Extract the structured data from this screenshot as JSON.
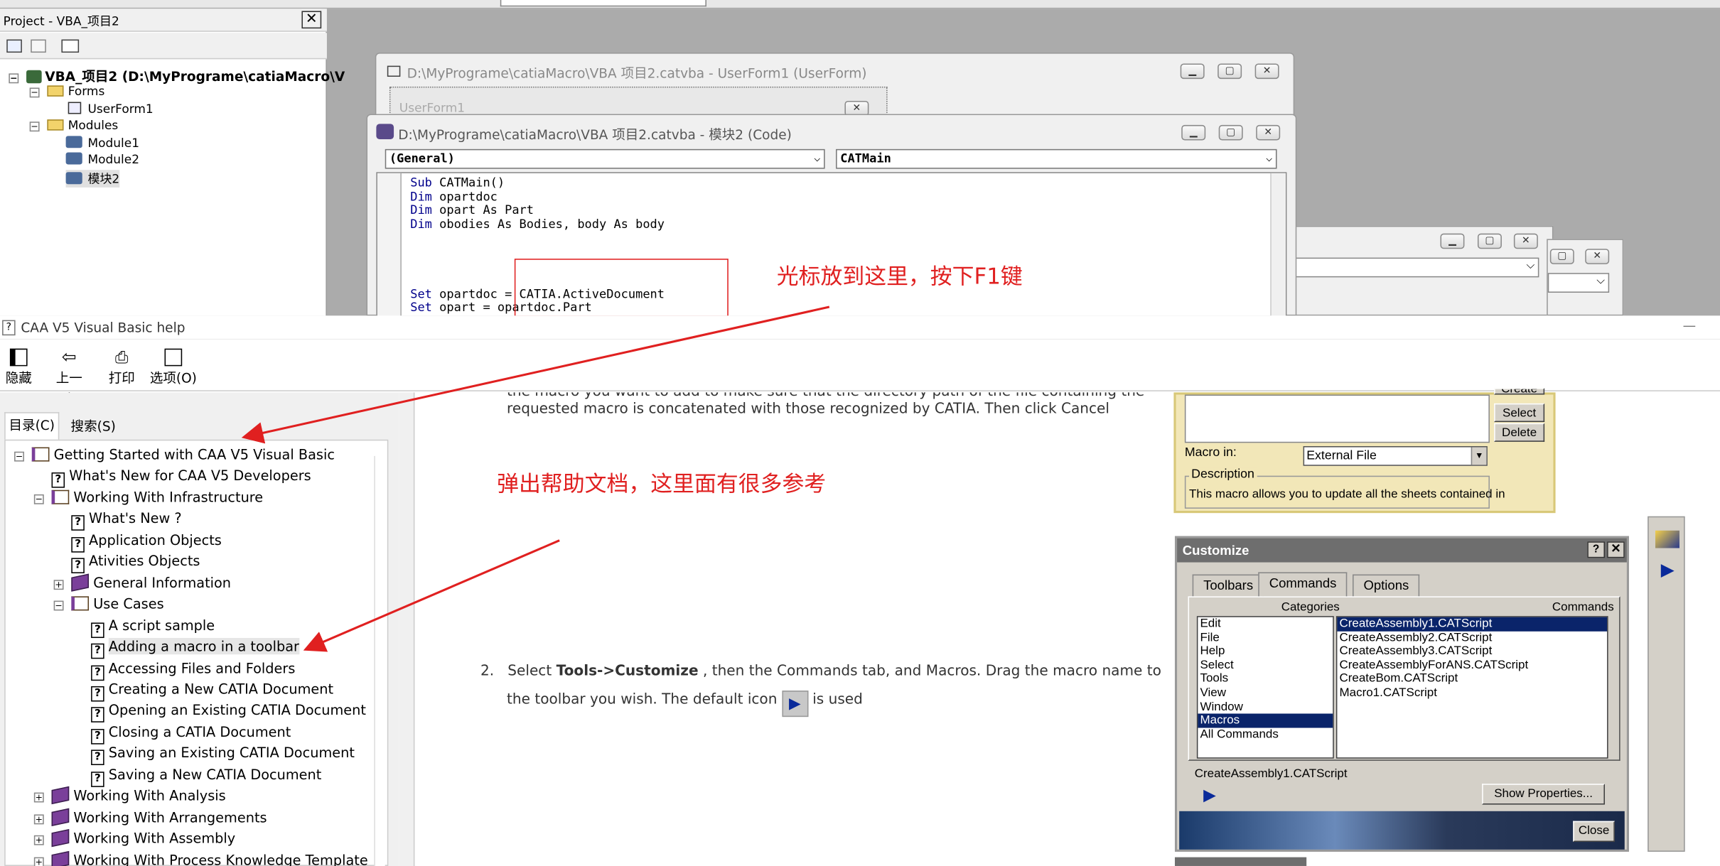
{
  "vba": {
    "project_title": "Project - VBA_项目2",
    "tree_root": "VBA_项目2 (D:\\MyPrograme\\catiaMacro\\V",
    "tree_forms": "Forms",
    "tree_userform": "UserForm1",
    "tree_modules": "Modules",
    "tree_module1": "Module1",
    "tree_module2": "Module2",
    "tree_module3": "模块2",
    "userform_window_title": "D:\\MyPrograme\\catiaMacro\\VBA 项目2.catvba - UserForm1 (UserForm)",
    "userform_caption": "UserForm1",
    "code_window_title": "D:\\MyPrograme\\catiaMacro\\VBA 项目2.catvba - 模块2 (Code)",
    "object_combo": "(General)",
    "proc_combo": "CATMain",
    "code_lines": [
      {
        "kw": "Sub",
        "rest": " CATMain()"
      },
      {
        "kw": "Dim",
        "rest": " opartdoc"
      },
      {
        "kw": "Dim",
        "rest": " opart As Part"
      },
      {
        "kw": "Dim",
        "rest": " obodies As Bodies, body As body"
      },
      {
        "kw": "",
        "rest": ""
      },
      {
        "kw": "",
        "rest": ""
      },
      {
        "kw": "",
        "rest": ""
      },
      {
        "kw": "",
        "rest": ""
      },
      {
        "kw": "Set",
        "rest": " opartdoc = CATIA.ActiveDocument"
      },
      {
        "kw": "Set",
        "rest": " opart = opartdoc.Part"
      }
    ]
  },
  "annotations": {
    "cursor_note": "光标放到这里，按下F1键",
    "help_note": "弹出帮助文档，这里面有很多参考",
    "color": "#e02020"
  },
  "help": {
    "title": "CAA V5 Visual Basic help",
    "toolbar": {
      "hide": "隐藏",
      "back": "上一步",
      "print": "打印",
      "options": "选项(O)"
    },
    "tabs": {
      "contents": "目录(C)",
      "search": "搜索(S)"
    },
    "tree": [
      {
        "label": "Getting Started with CAA V5 Visual Basic",
        "icon": "open-book-icon",
        "exp": "−",
        "level": 0
      },
      {
        "label": "What's New for CAA V5 Developers",
        "icon": "help-page-icon",
        "exp": "",
        "level": 1
      },
      {
        "label": "Working With Infrastructure",
        "icon": "open-book-icon",
        "exp": "−",
        "level": 1
      },
      {
        "label": "What's New ?",
        "icon": "help-page-icon",
        "exp": "",
        "level": 2
      },
      {
        "label": "Application Objects",
        "icon": "help-page-icon",
        "exp": "",
        "level": 2
      },
      {
        "label": "Ativities Objects",
        "icon": "help-page-icon",
        "exp": "",
        "level": 2
      },
      {
        "label": "General Information",
        "icon": "book-icon",
        "exp": "+",
        "level": 2
      },
      {
        "label": "Use Cases",
        "icon": "open-book-icon",
        "exp": "−",
        "level": 2
      },
      {
        "label": "A script sample",
        "icon": "help-page-icon",
        "exp": "",
        "level": 3
      },
      {
        "label": "Adding a macro in a toolbar",
        "icon": "help-page-icon",
        "exp": "",
        "level": 3,
        "selected": true
      },
      {
        "label": "Accessing Files and Folders",
        "icon": "help-page-icon",
        "exp": "",
        "level": 3
      },
      {
        "label": "Creating a New CATIA Document",
        "icon": "help-page-icon",
        "exp": "",
        "level": 3
      },
      {
        "label": "Opening an Existing CATIA Document",
        "icon": "help-page-icon",
        "exp": "",
        "level": 3
      },
      {
        "label": "Closing a CATIA Document",
        "icon": "help-page-icon",
        "exp": "",
        "level": 3
      },
      {
        "label": "Saving an Existing CATIA Document",
        "icon": "help-page-icon",
        "exp": "",
        "level": 3
      },
      {
        "label": "Saving a New CATIA Document",
        "icon": "help-page-icon",
        "exp": "",
        "level": 3
      },
      {
        "label": "Working With Analysis",
        "icon": "book-icon",
        "exp": "+",
        "level": 1
      },
      {
        "label": "Working With Arrangements",
        "icon": "book-icon",
        "exp": "+",
        "level": 1
      },
      {
        "label": "Working With Assembly",
        "icon": "book-icon",
        "exp": "+",
        "level": 1
      },
      {
        "label": "Working With Process Knowledge Template",
        "icon": "book-icon",
        "exp": "+",
        "level": 1
      }
    ],
    "content": {
      "partial_line": "the macro you want to add to make sure that the directory path of the file containing the",
      "line2": "requested macro is concatenated with those recognized by CATIA. Then click Cancel",
      "step_num": "2.",
      "step_pre": "Select ",
      "step_bold": "Tools->Customize",
      "step_post": " , then the Commands tab, and Macros. Drag the macro name to",
      "step_line2_pre": "the toolbar you wish. The default icon ",
      "step_line2_post": " is used"
    },
    "macro_dialog": {
      "select_btn": "Select",
      "delete_btn": "Delete",
      "partial_btn": "Create",
      "macro_in_label": "Macro in:",
      "macro_in_value": "External File",
      "description_label": "Description",
      "description_text": "This macro allows you to update all the sheets contained in"
    },
    "customize": {
      "title": "Customize",
      "tabs": [
        "Toolbars",
        "Commands",
        "Options"
      ],
      "categories_label": "Categories",
      "commands_label": "Commands",
      "categories": [
        "Edit",
        "File",
        "Help",
        "Select",
        "Tools",
        "View",
        "Window",
        "Macros",
        "All Commands"
      ],
      "commands": [
        "CreateAssembly1.CATScript",
        "CreateAssembly2.CATScript",
        "CreateAssembly3.CATScript",
        "CreateAssemblyForANS.CATScript",
        "CreateBom.CATScript",
        "Macro1.CATScript"
      ],
      "selected_command": "CreateAssembly1.CATScript",
      "show_properties": "Show Properties...",
      "close": "Close"
    }
  }
}
